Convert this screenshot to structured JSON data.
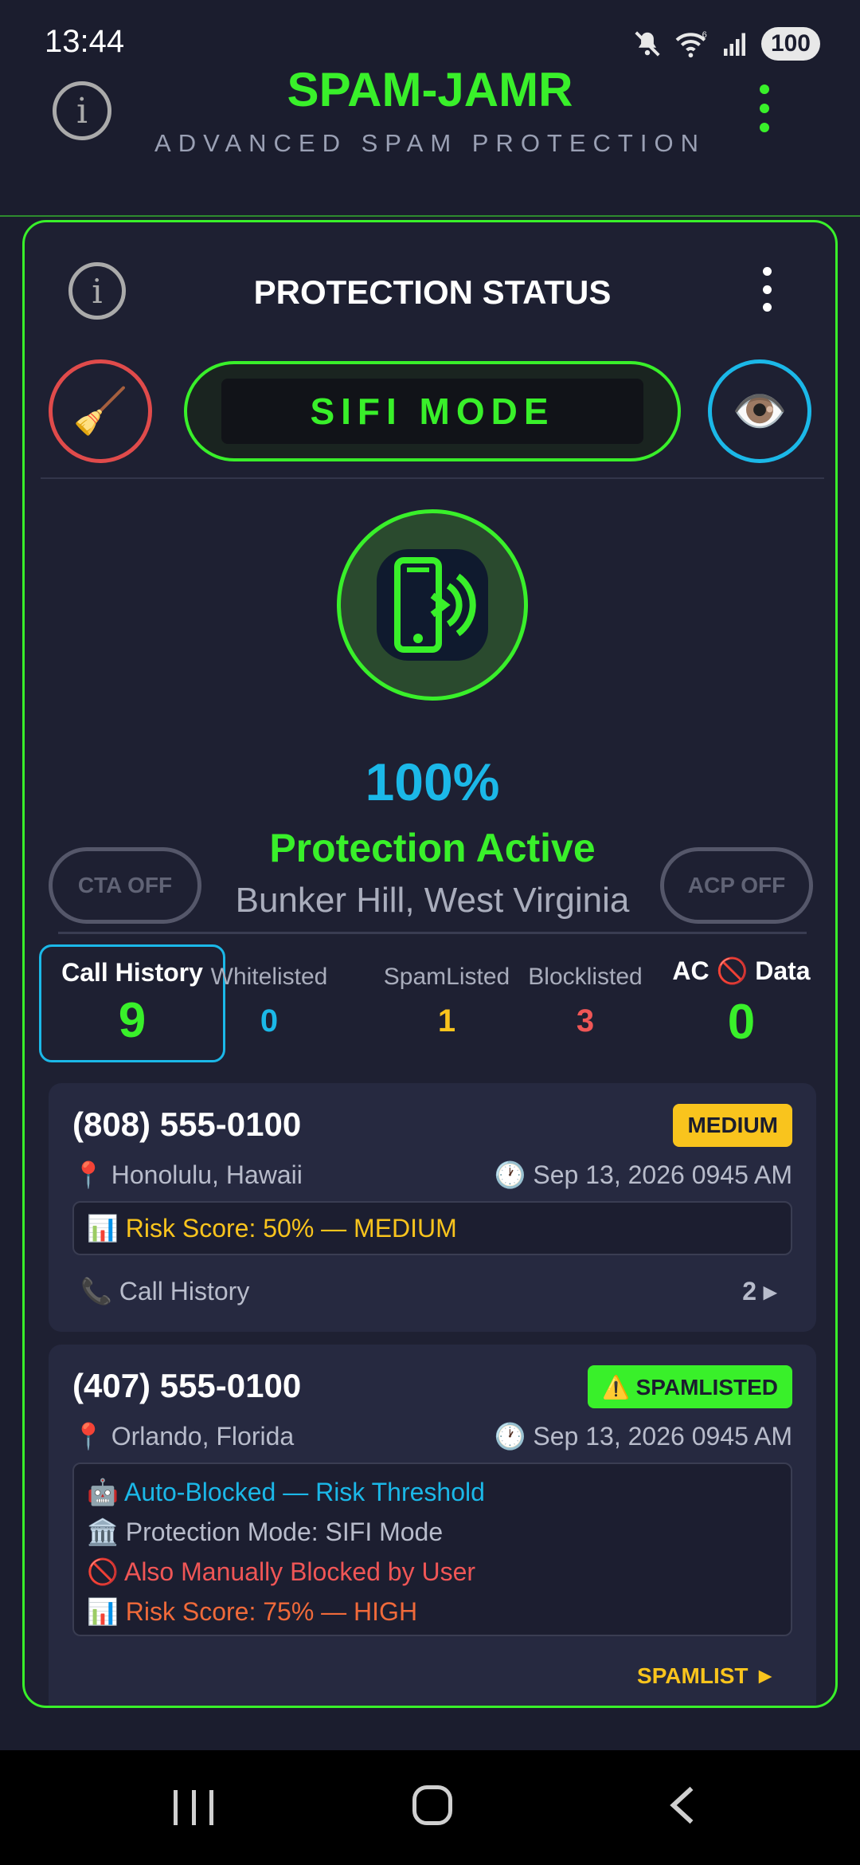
{
  "status_bar": {
    "time": "13:44",
    "battery": "100",
    "wifi_sup": "6"
  },
  "header": {
    "title": "SPAM-JAMR",
    "subtitle": "ADVANCED SPAM PROTECTION",
    "info_icon": "info-icon",
    "menu_icon": "more-vertical-icon"
  },
  "card": {
    "title": "PROTECTION STATUS",
    "mode_label": "SIFI MODE",
    "broom_icon": "🧹",
    "eye_icon": "👁️",
    "percent": "100%",
    "status": "Protection Active",
    "location": "Bunker Hill, West Virginia",
    "cta_label": "CTA OFF",
    "acp_label": "ACP OFF"
  },
  "stats": {
    "call_history": {
      "label": "Call History",
      "value": "9"
    },
    "whitelisted": {
      "label": "Whitelisted",
      "value": "0"
    },
    "spamlisted": {
      "label": "SpamListed",
      "value": "1"
    },
    "blocklisted": {
      "label": "Blocklisted",
      "value": "3"
    },
    "ac_data": {
      "label_pre": "AC",
      "label_icon": "🚫",
      "label_post": "Data",
      "value": "0"
    }
  },
  "calls": [
    {
      "phone": "(808) 555-0100",
      "badge": "MEDIUM",
      "location": "📍 Honolulu, Hawaii",
      "date": "🕐 Sep 13, 2026 0945 AM",
      "risk": "📊 Risk Score: 50% — MEDIUM",
      "history_label": "📞 Call History",
      "history_count": "2  ▸"
    },
    {
      "phone": "(407) 555-0100",
      "badge": "⚠️ SPAMLISTED",
      "location": "📍 Orlando, Florida",
      "date": "🕐 Sep 13, 2026 0945 AM",
      "auto": "🤖 Auto-Blocked — Risk Threshold",
      "mode": "🏛️ Protection Mode: SIFI Mode",
      "manual": "🚫 Also Manually Blocked by User",
      "risk": "📊 Risk Score: 75% — HIGH",
      "link": "SPAMLIST ►"
    }
  ],
  "colors": {
    "accent": "#39f02a",
    "blue": "#1bb8e8",
    "yellow": "#f9c41d",
    "red": "#f05656",
    "bg": "#1b1d2e"
  }
}
